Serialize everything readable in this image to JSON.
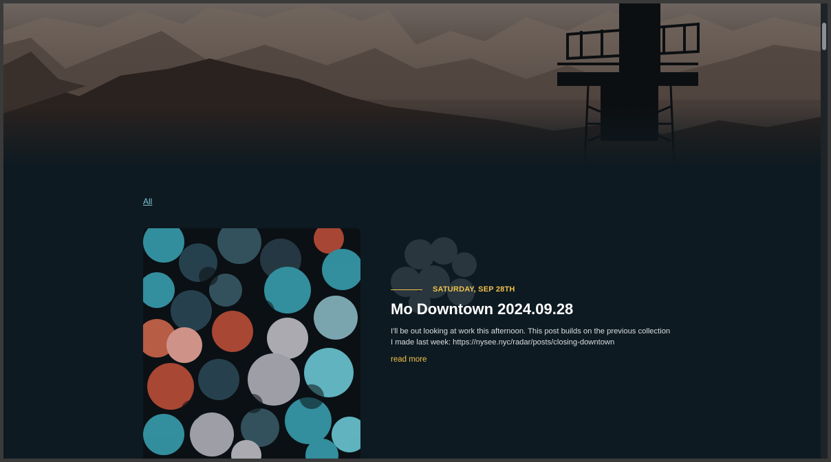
{
  "filters": {
    "all_label": "All"
  },
  "post": {
    "date": "SATURDAY, SEP 28TH",
    "title": "Mo Downtown 2024.09.28",
    "excerpt": "I'll be out looking at work this afternoon. This post builds on the previous collection I made last week: https://nysee.nyc/radar/posts/closing-downtown",
    "read_more": "read more"
  },
  "colors": {
    "page_bg": "#0e1a21",
    "accent_gold": "#f0c14b",
    "link_blue": "#7fc3d6",
    "title_white": "#ffffff"
  }
}
